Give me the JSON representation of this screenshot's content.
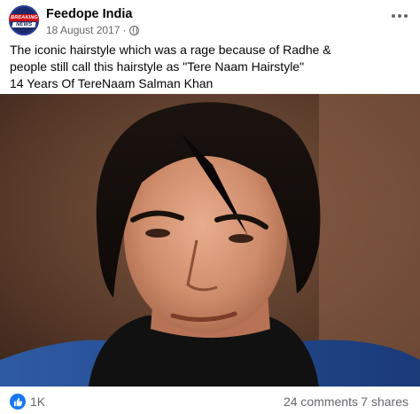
{
  "post": {
    "page_name": "Feedope India",
    "date": "18 August 2017",
    "separator": "·",
    "privacy_icon": "globe-icon",
    "avatar": {
      "line1": "BREAKING",
      "line2": "NEWS"
    },
    "caption_lines": [
      "The iconic hairstyle which was a rage because of Radhe &",
      "people still call this hairstyle as \"Tere Naam Hairstyle\"",
      "14 Years Of TereNaam Salman Khan"
    ],
    "photo_description_icon": "photo",
    "reactions": {
      "icon": "like-icon",
      "count": "1K"
    },
    "comments": "24 comments",
    "shares": "7 shares"
  },
  "colors": {
    "accent": "#1877f2",
    "meta_text": "#65676b",
    "text": "#050505"
  }
}
